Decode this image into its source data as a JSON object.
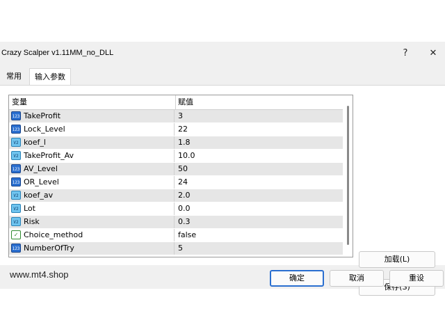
{
  "window": {
    "title": "Crazy Scalper v1.11MM_no_DLL",
    "help_label": "?",
    "close_label": "✕"
  },
  "tabs": [
    {
      "label": "常用"
    },
    {
      "label": "输入参数"
    }
  ],
  "grid": {
    "columns": {
      "variable": "变量",
      "value": "赋值"
    },
    "rows": [
      {
        "type": "int",
        "icon": "int-icon",
        "name": "TakeProfit",
        "value": "3"
      },
      {
        "type": "int",
        "icon": "int-icon",
        "name": "Lock_Level",
        "value": "22"
      },
      {
        "type": "double",
        "icon": "double-icon",
        "name": "koef_l",
        "value": "1.8"
      },
      {
        "type": "double",
        "icon": "double-icon",
        "name": "TakeProfit_Av",
        "value": "10.0"
      },
      {
        "type": "int",
        "icon": "int-icon",
        "name": "AV_Level",
        "value": "50"
      },
      {
        "type": "int",
        "icon": "int-icon",
        "name": "OR_Level",
        "value": "24"
      },
      {
        "type": "double",
        "icon": "double-icon",
        "name": "koef_av",
        "value": "2.0"
      },
      {
        "type": "double",
        "icon": "double-icon",
        "name": "Lot",
        "value": "0.0"
      },
      {
        "type": "double",
        "icon": "double-icon",
        "name": "Risk",
        "value": "0.3"
      },
      {
        "type": "bool",
        "icon": "bool-icon",
        "name": "Choice_method",
        "value": "false"
      },
      {
        "type": "int",
        "icon": "int-icon",
        "name": "NumberOfTry",
        "value": "5"
      }
    ]
  },
  "side_buttons": {
    "load": "加载(L)",
    "save": "保存(S)"
  },
  "footer": {
    "watermark": "www.mt4.shop",
    "ok": "确定",
    "cancel": "取消",
    "reset": "重设"
  },
  "colors": {
    "accent": "#2a6fd0",
    "row_alt": "#e6e6e6",
    "dialog_bg": "#f0f0f0"
  }
}
